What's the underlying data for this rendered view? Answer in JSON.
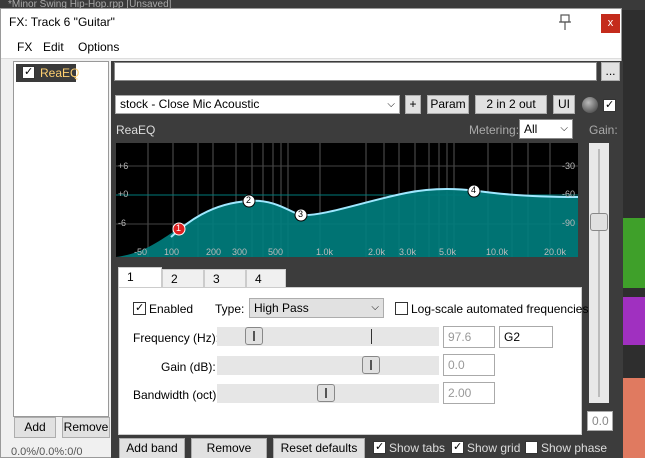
{
  "daw": {
    "title": "*Minor Swing Hip-Hop.rpp  [Unsaved]"
  },
  "window": {
    "title": "FX: Track 6 \"Guitar\"",
    "close_label": "x",
    "menu": [
      "FX",
      "Edit",
      "Options"
    ]
  },
  "fx_list": {
    "items": [
      {
        "label": "ReaEQ",
        "enabled": true
      }
    ],
    "add_label": "Add",
    "remove_label": "Remove",
    "status": "0.0%/0.0%:0/0"
  },
  "plugin": {
    "top_field_value": "",
    "more_label": "...",
    "preset": "stock - Close Mic Acoustic",
    "plus_label": "+",
    "param_label": "Param",
    "routing_label": "2 in 2 out",
    "ui_label": "UI",
    "name": "ReaEQ",
    "metering_label": "Metering:",
    "metering_value": "All",
    "gain_label": "Gain:",
    "gain_value": "0.0"
  },
  "graph": {
    "db_labels_left": [
      "+6",
      "+0",
      "-6",
      "-50"
    ],
    "db_labels_right": [
      "-30",
      "-60",
      "-90"
    ],
    "freq_labels": [
      "100",
      "200",
      "300",
      "500",
      "1.0k",
      "2.0k",
      "3.0k",
      "5.0k",
      "10.0k",
      "20.0k"
    ],
    "band_nodes": [
      "1",
      "2",
      "3",
      "4"
    ],
    "colors": {
      "fill": "#008080",
      "curve": "#9fe8ff",
      "selected_node": "#e02020"
    }
  },
  "band_tabs": [
    "1",
    "2",
    "3",
    "4"
  ],
  "band": {
    "enabled_label": "Enabled",
    "enabled": true,
    "type_label": "Type:",
    "type_value": "High Pass",
    "log_scale_label": "Log-scale automated frequencies",
    "log_scale": false,
    "frequency_label": "Frequency (Hz):",
    "frequency_value": "97.6",
    "note_value": "G2",
    "gain_label": "Gain (dB):",
    "gain_value": "0.0",
    "bandwidth_label": "Bandwidth (oct):",
    "bandwidth_value": "2.00"
  },
  "footer": {
    "add_band": "Add band",
    "remove_band": "Remove band",
    "reset": "Reset defaults",
    "show_tabs": "Show tabs",
    "show_tabs_on": true,
    "show_grid": "Show grid",
    "show_grid_on": true,
    "show_phase": "Show phase",
    "show_phase_on": false
  }
}
